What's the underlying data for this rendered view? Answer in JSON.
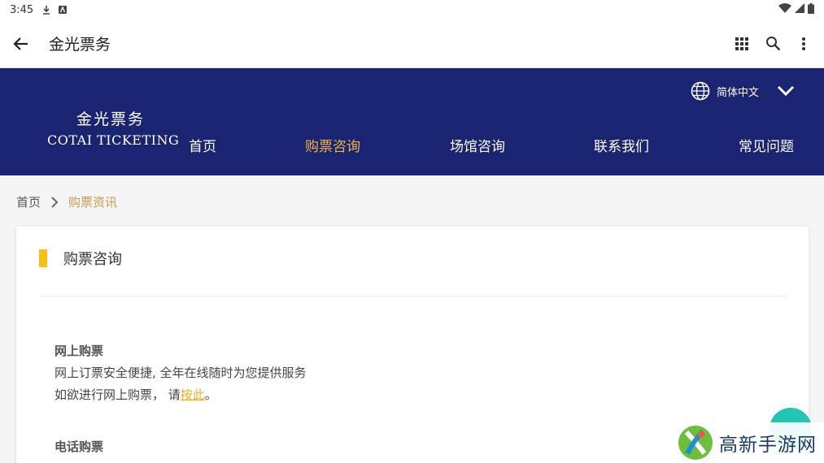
{
  "status_bar": {
    "time": "3:45"
  },
  "app_bar": {
    "title": "金光票务"
  },
  "header": {
    "logo_cn": "金光票务",
    "logo_en": "COTAI TICKETING",
    "language": "简体中文",
    "nav": [
      {
        "label": "首页",
        "active": false
      },
      {
        "label": "购票咨询",
        "active": true
      },
      {
        "label": "场馆咨询",
        "active": false
      },
      {
        "label": "联系我们",
        "active": false
      },
      {
        "label": "常见问题",
        "active": false
      }
    ],
    "colors": {
      "background": "#1a2470",
      "active": "#f3b33d"
    }
  },
  "breadcrumb": {
    "home": "首页",
    "current": "购票资讯"
  },
  "card": {
    "title": "购票咨询",
    "sections": [
      {
        "title": "网上购票",
        "line1": "网上订票安全便捷, 全年在线随时为您提供服务",
        "line2_prefix": "如欲进行网上购票， 请",
        "line2_link": "按此",
        "line2_suffix": "。"
      },
      {
        "title": "电话购票"
      }
    ]
  },
  "watermark": {
    "text": "高新手游网"
  }
}
